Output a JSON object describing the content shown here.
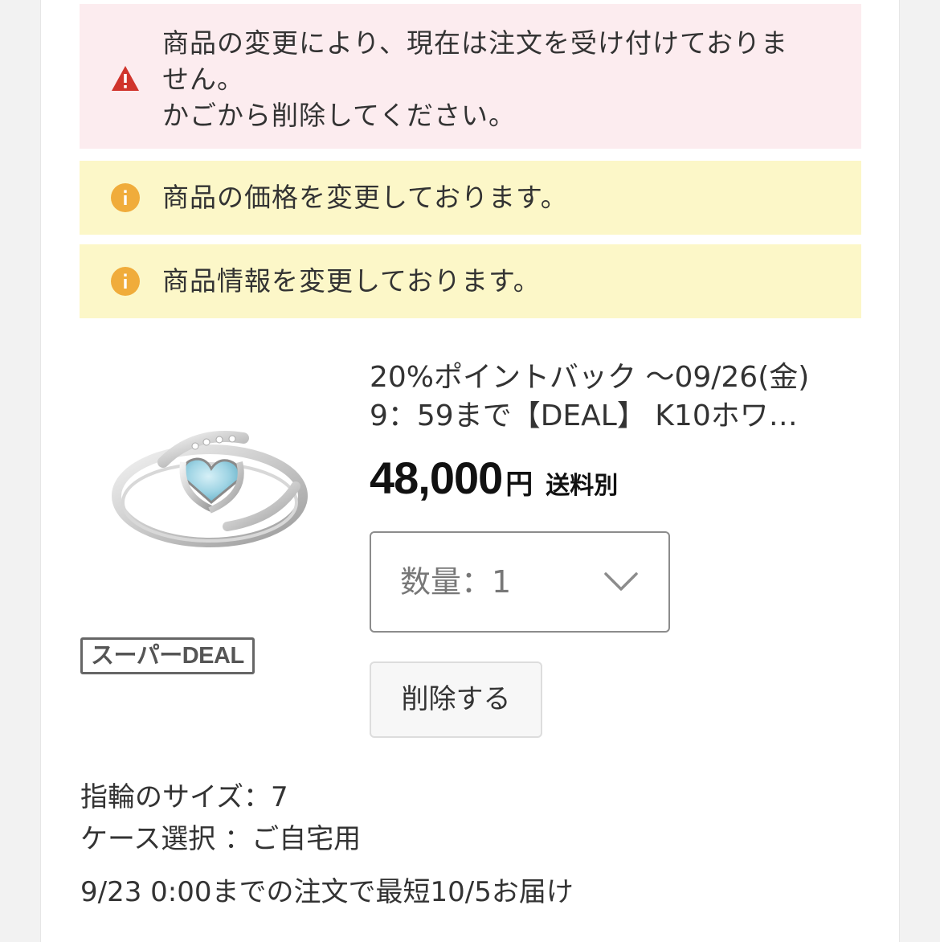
{
  "alerts": {
    "error": {
      "icon": "warning-icon",
      "color": "#d0342c",
      "background": "#fcecef",
      "lines": [
        "商品の変更により、現在は注文を受け付けておりま",
        "せん。",
        "かごから削除してください。"
      ]
    },
    "price_changed": {
      "icon": "info-icon",
      "color": "#f0ac3b",
      "background": "#fcf7c8",
      "text": "商品の価格を変更しております。"
    },
    "info_changed": {
      "icon": "info-icon",
      "color": "#f0ac3b",
      "background": "#fcf7c8",
      "text": "商品情報を変更しております。"
    }
  },
  "product": {
    "image_icon": "ring-image",
    "badge": "スーパーDEAL",
    "title_lines": [
      "20%ポイントバック ～09/26(金)",
      "9：59まで【DEAL】 K10ホワ…"
    ],
    "price": "48,000",
    "price_unit": "円",
    "shipping": "送料別",
    "quantity_label": "数量：1",
    "delete_label": "削除する",
    "options": [
      "指輪のサイズ：7",
      "ケース選択 ：ご自宅用"
    ],
    "delivery": "9/23 0:00までの注文で最短10/5お届け"
  }
}
